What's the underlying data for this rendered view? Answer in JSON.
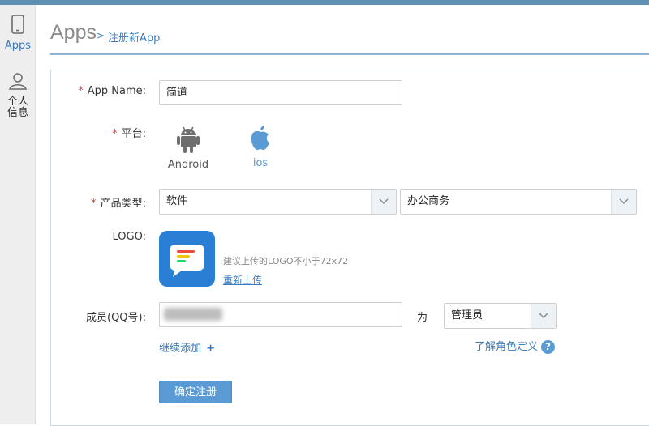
{
  "sidebar": {
    "items": [
      {
        "label": "Apps"
      },
      {
        "label": "个人\n信息"
      }
    ]
  },
  "header": {
    "title": "Apps",
    "breadcrumb_sep": ">",
    "breadcrumb": "注册新App"
  },
  "form": {
    "app_name": {
      "label": "App Name:",
      "value": "简道"
    },
    "platform": {
      "label": "平台:",
      "options": [
        {
          "name": "Android"
        },
        {
          "name": "ios"
        }
      ]
    },
    "category": {
      "label": "产品类型:",
      "primary": "软件",
      "secondary": "办公商务"
    },
    "logo": {
      "label": "LOGO:",
      "hint": "建议上传的LOGO不小于72x72",
      "reupload": "重新上传"
    },
    "members": {
      "label": "成员(QQ号):",
      "as_label": "为",
      "role": "管理员",
      "add_more": "继续添加",
      "role_help": "了解角色定义"
    },
    "submit": "确定注册"
  },
  "colors": {
    "accent": "#3a7bbd",
    "button": "#5b9bd5",
    "required": "#e03c3c",
    "topbar": "#5f8fb3",
    "logo_bg": "#2a7fd4"
  }
}
